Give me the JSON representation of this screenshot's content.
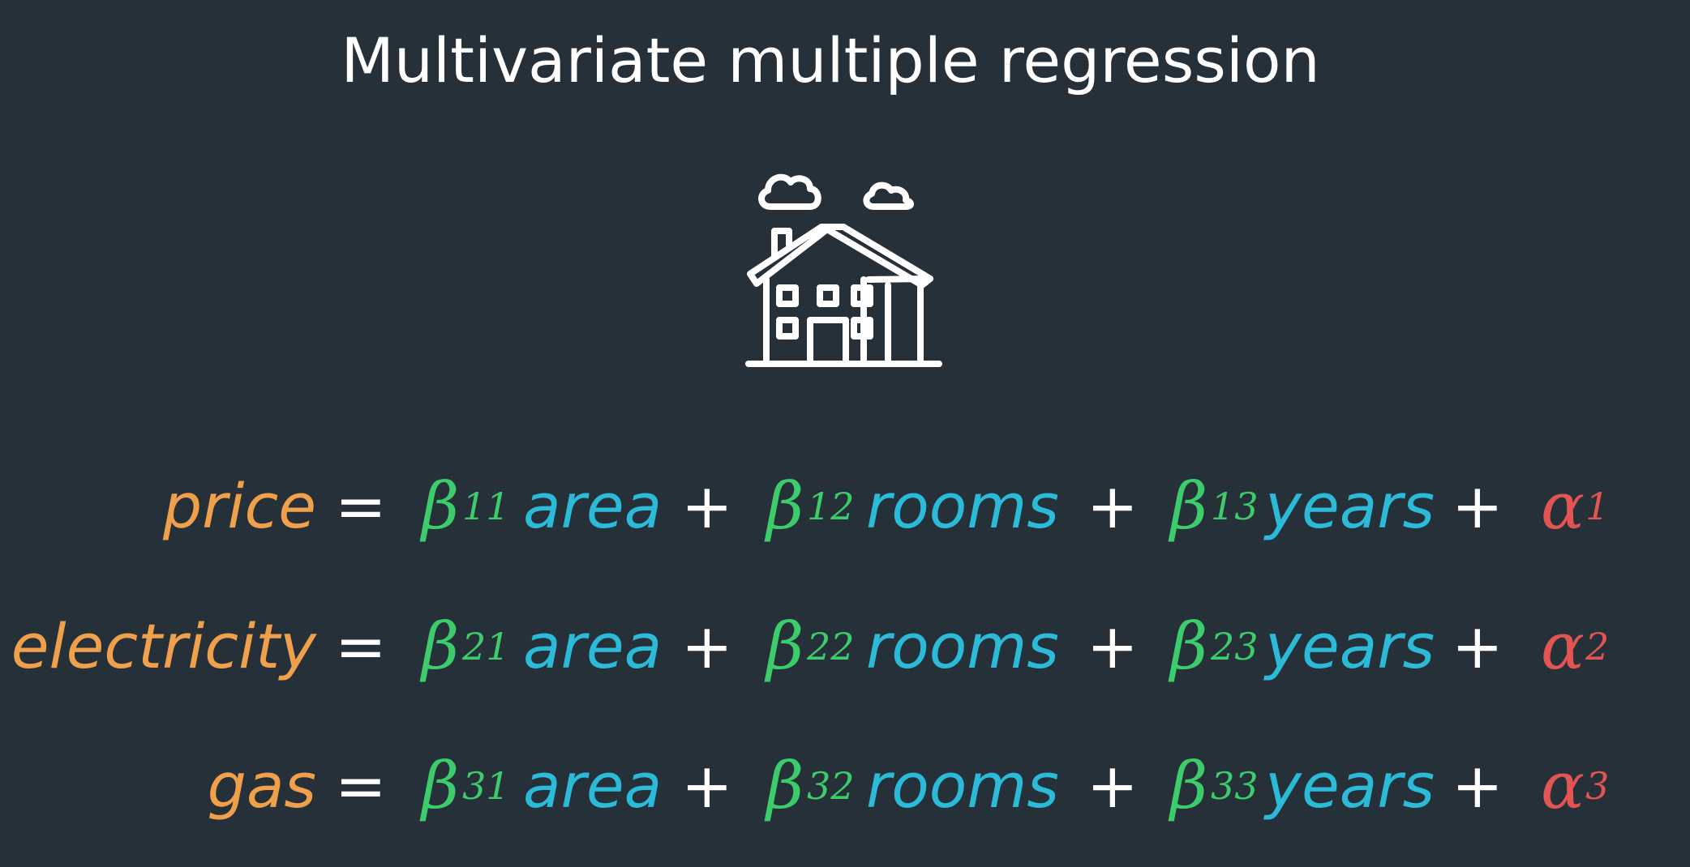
{
  "slide": {
    "title": "Multivariate multiple regression",
    "icon": "house-icon",
    "colors": {
      "background": "#263039",
      "target": "#f0a04b",
      "coefficient": "#3dcc6b",
      "feature": "#2bbad8",
      "intercept": "#e25552",
      "operator": "#ffffff"
    }
  },
  "equations": [
    {
      "target": "price",
      "equals": "=",
      "terms": [
        {
          "coef": "β",
          "sub": "11",
          "feature": "area"
        },
        {
          "coef": "β",
          "sub": "12",
          "feature": "rooms"
        },
        {
          "coef": "β",
          "sub": "13",
          "feature": "years"
        }
      ],
      "plus": "+",
      "intercept": {
        "symbol": "α",
        "sub": "1"
      }
    },
    {
      "target": "electricity",
      "equals": "=",
      "terms": [
        {
          "coef": "β",
          "sub": "21",
          "feature": "area"
        },
        {
          "coef": "β",
          "sub": "22",
          "feature": "rooms"
        },
        {
          "coef": "β",
          "sub": "23",
          "feature": "years"
        }
      ],
      "plus": "+",
      "intercept": {
        "symbol": "α",
        "sub": "2"
      }
    },
    {
      "target": "gas",
      "equals": "=",
      "terms": [
        {
          "coef": "β",
          "sub": "31",
          "feature": "area"
        },
        {
          "coef": "β",
          "sub": "32",
          "feature": "rooms"
        },
        {
          "coef": "β",
          "sub": "33",
          "feature": "years"
        }
      ],
      "plus": "+",
      "intercept": {
        "symbol": "α",
        "sub": "3"
      }
    }
  ]
}
